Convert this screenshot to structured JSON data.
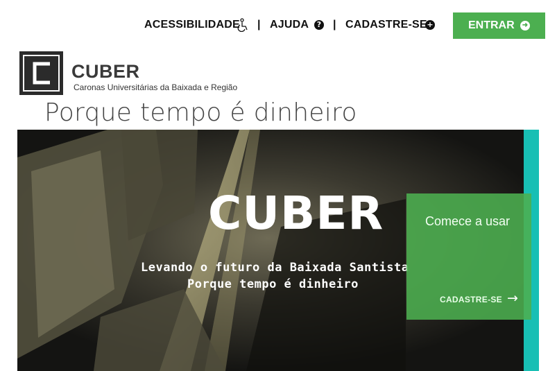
{
  "nav": {
    "accessibility": "ACESSIBILIDADE",
    "separator": "|",
    "help": "AJUDA",
    "signup": "CADASTRE-SE",
    "login": "ENTRAR",
    "icons": {
      "accessibility": "wheelchair-icon",
      "help": "question-circle-icon",
      "signup": "plus-circle-icon",
      "login": "arrow-circle-right-icon"
    }
  },
  "brand": {
    "name": "CUBER",
    "subtitle": "Caronas Universitárias da Baixada e Região",
    "tagline": "Porque tempo é dinheiro"
  },
  "hero": {
    "title": "CUBER",
    "line1": "Levando o futuro da Baixada Santista",
    "line2": "Porque tempo é dinheiro"
  },
  "card": {
    "title": "Comece a usar",
    "link": "CADASTRE-SE",
    "arrow_icon": "arrow-right-icon"
  },
  "colors": {
    "accent_green": "#4caf50",
    "teal": "#18bfb4",
    "text_dark": "#111111"
  }
}
